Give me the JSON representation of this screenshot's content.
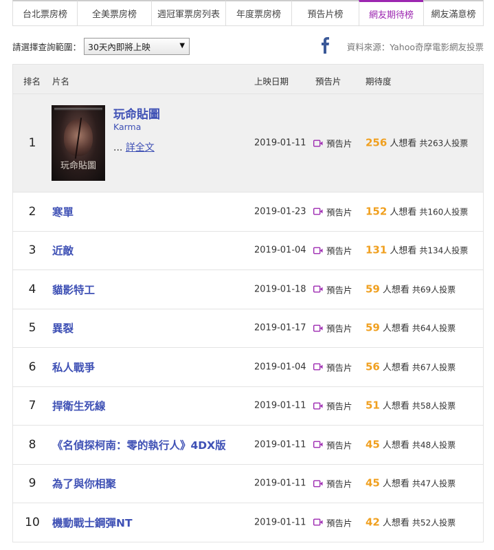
{
  "tabs": [
    {
      "label": "台北票房榜",
      "active": false
    },
    {
      "label": "全美票房榜",
      "active": false
    },
    {
      "label": "週冠軍票房列表",
      "active": false
    },
    {
      "label": "年度票房榜",
      "active": false
    },
    {
      "label": "預告片榜",
      "active": false
    },
    {
      "label": "網友期待榜",
      "active": true
    },
    {
      "label": "網友滿意榜",
      "active": false
    }
  ],
  "filter": {
    "label": "請選擇查詢範圍：",
    "selected": "30天內即將上映",
    "arrow": "▼"
  },
  "source": "資料來源：Yahoo奇摩電影網友投票",
  "header": {
    "rank": "排名",
    "title": "片名",
    "date": "上映日期",
    "trailer": "預告片",
    "expect": "期待度"
  },
  "labels": {
    "trailer": "預告片",
    "want_suffix": "人想看",
    "more_prefix": "...",
    "more_link": "詳全文"
  },
  "first": {
    "poster_title": "玩命貼圖",
    "en_title": "Karma"
  },
  "rows": [
    {
      "rank": "1",
      "title": "玩命貼圖",
      "date": "2019-01-11",
      "want": "256",
      "total": "共263人投票"
    },
    {
      "rank": "2",
      "title": "寒單",
      "date": "2019-01-23",
      "want": "152",
      "total": "共160人投票"
    },
    {
      "rank": "3",
      "title": "近敵",
      "date": "2019-01-04",
      "want": "131",
      "total": "共134人投票"
    },
    {
      "rank": "4",
      "title": "貓影特工",
      "date": "2019-01-18",
      "want": "59",
      "total": "共69人投票"
    },
    {
      "rank": "5",
      "title": "異裂",
      "date": "2019-01-17",
      "want": "59",
      "total": "共64人投票"
    },
    {
      "rank": "6",
      "title": "私人戰爭",
      "date": "2019-01-04",
      "want": "56",
      "total": "共67人投票"
    },
    {
      "rank": "7",
      "title": "捍衛生死線",
      "date": "2019-01-11",
      "want": "51",
      "total": "共58人投票"
    },
    {
      "rank": "8",
      "title": "《名偵探柯南：零的執行人》4DX版",
      "date": "2019-01-11",
      "want": "45",
      "total": "共48人投票"
    },
    {
      "rank": "9",
      "title": "為了與你相聚",
      "date": "2019-01-11",
      "want": "45",
      "total": "共47人投票"
    },
    {
      "rank": "10",
      "title": "機動戰士鋼彈NT",
      "date": "2019-01-11",
      "want": "42",
      "total": "共52人投票"
    }
  ],
  "colors": {
    "accent": "#9c27b0",
    "link": "#3f51b5",
    "want": "#f0a020"
  }
}
